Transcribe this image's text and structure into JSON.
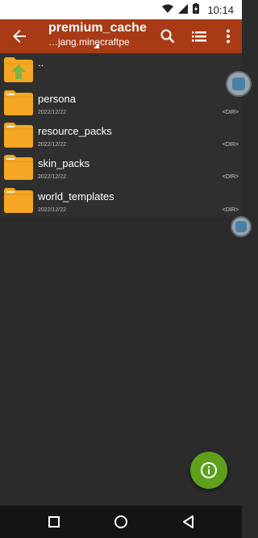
{
  "status_bar": {
    "time": "10:14"
  },
  "app_bar": {
    "title": "premium_cache",
    "subtitle": "…jang.minecraftpe",
    "icons": [
      "back-arrow-icon",
      "search-icon",
      "list-view-icon",
      "more-vert-icon"
    ]
  },
  "files": {
    "parent": {
      "name": ".."
    },
    "items": [
      {
        "name": "persona",
        "date": "2022/12/22",
        "type": "<DIR>"
      },
      {
        "name": "resource_packs",
        "date": "2022/12/22",
        "type": "<DIR>"
      },
      {
        "name": "skin_packs",
        "date": "2022/12/22",
        "type": "<DIR>"
      },
      {
        "name": "world_templates",
        "date": "2022/12/22",
        "type": "<DIR>"
      }
    ]
  },
  "fab": {
    "icon": "info-icon"
  },
  "nav": {
    "icons": [
      "recent-apps-icon",
      "home-icon",
      "back-icon"
    ]
  },
  "colors": {
    "app_bar": "#a93a16",
    "folder": "#f5a623",
    "parent_arrow": "#7cb342",
    "fab": "#5ea01c",
    "background": "#2b2b2b"
  }
}
